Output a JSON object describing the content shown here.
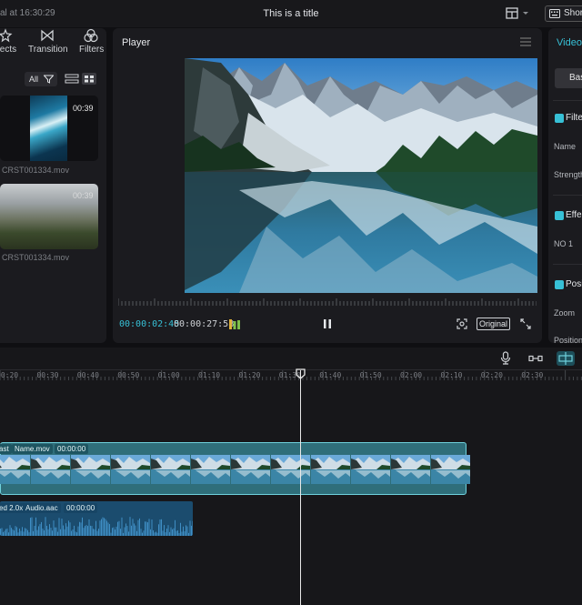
{
  "titlebar": {
    "autosave": "al at 16:30:29",
    "title": "This is a title",
    "shortcut_label": "Shor"
  },
  "media": {
    "tabs": [
      {
        "label": "fects",
        "icon": "effects-icon"
      },
      {
        "label": "Transition",
        "icon": "transition-icon"
      },
      {
        "label": "Filters",
        "icon": "filters-icon"
      }
    ],
    "filter_label": "All",
    "items": [
      {
        "name": "CRST001334.mov",
        "duration": "00:39"
      },
      {
        "name": "CRST001334.mov",
        "duration": "00:39"
      }
    ]
  },
  "player": {
    "title": "Player",
    "current_time": "00:00:02:45",
    "total_time": "00:00:27:58",
    "ratio_label": "Original"
  },
  "inspector": {
    "tab": "Video",
    "basic_label": "Bas",
    "sections": [
      {
        "title": "Filte",
        "labels": [
          "Name",
          "Strength"
        ]
      },
      {
        "title": "Effe",
        "labels": [
          "NO 1"
        ]
      },
      {
        "title": "Posi",
        "labels": [
          "Zoom",
          "Position"
        ]
      }
    ]
  },
  "timeline": {
    "ruler": [
      "00:20",
      "00:30",
      "00:40",
      "00:50",
      "01:00",
      "01:10",
      "01:20",
      "01:30",
      "01:40",
      "01:50",
      "02:00",
      "02:10",
      "02:20",
      "02:30"
    ],
    "video_clip": {
      "tags": [
        "ast",
        "Name.mov",
        "00:00:00"
      ]
    },
    "audio_clip": {
      "tags": [
        "ed 2.0x",
        "Audio.aac",
        "00:00:00"
      ]
    }
  },
  "colors": {
    "accent": "#37c0d6",
    "panel": "#1b1b1f",
    "background": "#0f0f12"
  }
}
